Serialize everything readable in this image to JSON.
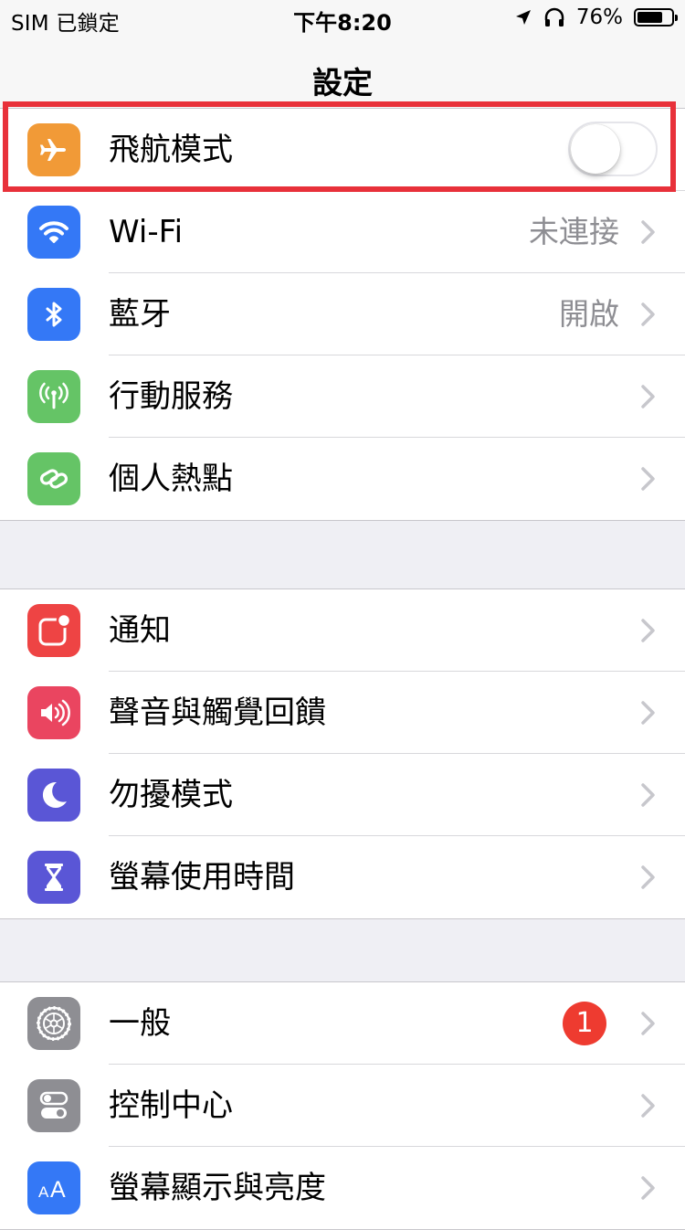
{
  "status_bar": {
    "carrier": "SIM 已鎖定",
    "time": "下午8:20",
    "battery_percent": "76%",
    "battery_level": 0.76,
    "icons": [
      "location-arrow-icon",
      "headphones-icon",
      "battery-icon"
    ]
  },
  "nav": {
    "title": "設定"
  },
  "colors": {
    "airplane": "#f19a37",
    "wifi": "#3478f6",
    "bluetooth": "#3478f6",
    "cellular": "#65c466",
    "hotspot": "#65c466",
    "notifications": "#ee4444",
    "sounds": "#ea4560",
    "dnd": "#5a56d6",
    "screentime": "#5a56d6",
    "general": "#8e8e93",
    "control": "#8e8e93",
    "display": "#3478f6",
    "highlight": "#e8313a"
  },
  "groups": [
    {
      "rows": [
        {
          "label": "飛航模式",
          "icon": "airplane-icon",
          "control": "toggle",
          "on": false
        },
        {
          "label": "Wi-Fi",
          "icon": "wifi-icon",
          "value": "未連接"
        },
        {
          "label": "藍牙",
          "icon": "bluetooth-icon",
          "value": "開啟"
        },
        {
          "label": "行動服務",
          "icon": "cellular-antenna-icon"
        },
        {
          "label": "個人熱點",
          "icon": "hotspot-link-icon"
        }
      ]
    },
    {
      "rows": [
        {
          "label": "通知",
          "icon": "notifications-icon"
        },
        {
          "label": "聲音與觸覺回饋",
          "icon": "speaker-icon"
        },
        {
          "label": "勿擾模式",
          "icon": "moon-icon"
        },
        {
          "label": "螢幕使用時間",
          "icon": "hourglass-icon"
        }
      ]
    },
    {
      "rows": [
        {
          "label": "一般",
          "icon": "gear-icon",
          "badge": "1"
        },
        {
          "label": "控制中心",
          "icon": "switches-icon"
        },
        {
          "label": "螢幕顯示與亮度",
          "icon": "text-size-icon"
        }
      ]
    }
  ]
}
